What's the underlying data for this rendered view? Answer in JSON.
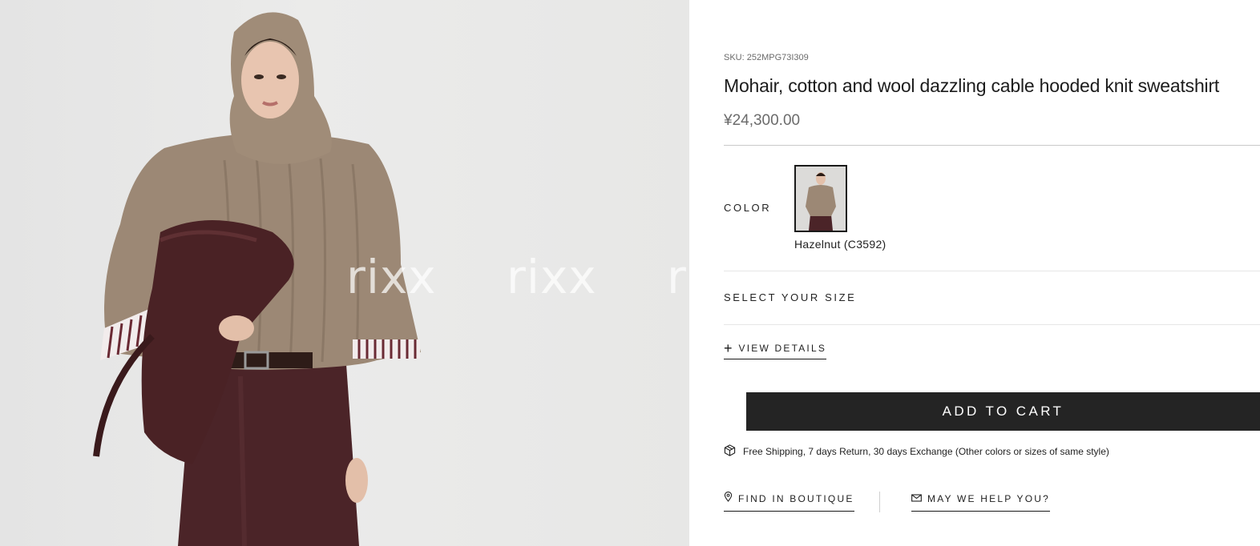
{
  "product": {
    "sku": "SKU: 252MPG73I309",
    "title": "Mohair, cotton and wool dazzling cable hooded knit sweatshirt",
    "price": "¥24,300.00"
  },
  "color": {
    "label": "COLOR",
    "selected_name": "Hazelnut (C3592)",
    "swatch_icon": "model-thumbnail"
  },
  "size": {
    "label": "SELECT YOUR SIZE"
  },
  "details": {
    "label": "VIEW DETAILS",
    "icon": "plus-icon"
  },
  "cart": {
    "label": "ADD TO CART",
    "bg": "#242424"
  },
  "shipping": {
    "icon": "box-icon",
    "text": "Free Shipping, 7 days Return, 30 days Exchange (Other colors or sizes of same style)"
  },
  "links": {
    "boutique": {
      "label": "FIND IN BOUTIQUE",
      "icon": "location-pin-icon"
    },
    "help": {
      "label": "MAY WE HELP YOU?",
      "icon": "envelope-icon"
    }
  },
  "watermarks": [
    "rixx",
    "rixx",
    "ri"
  ],
  "colors": {
    "sweater": "#9a8672",
    "leather": "#4a2326",
    "background": "#e8e8e7"
  }
}
